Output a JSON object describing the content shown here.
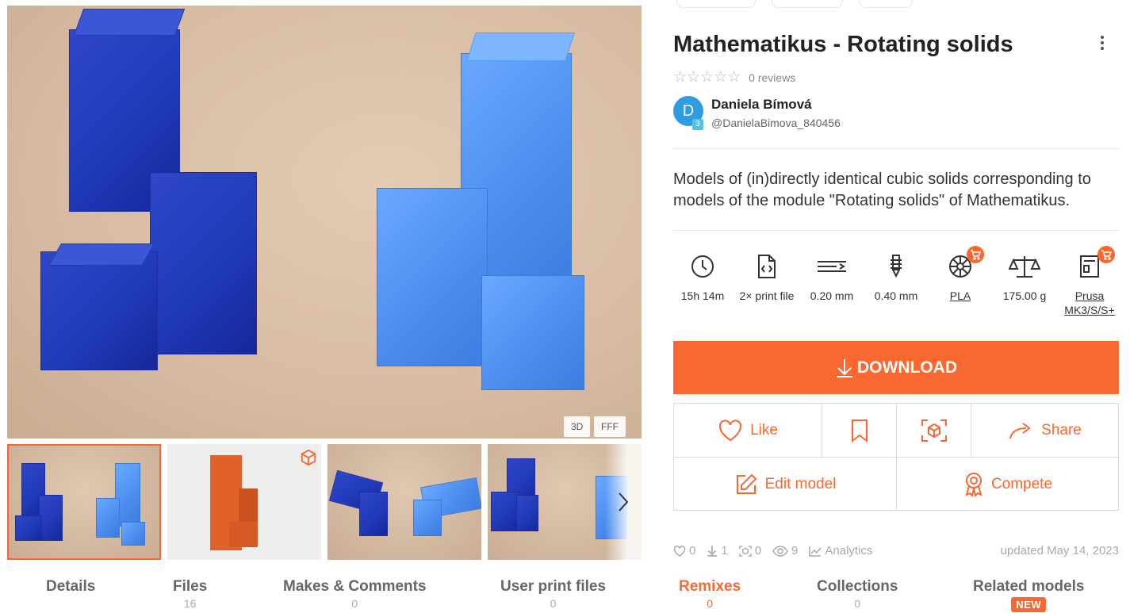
{
  "gallery": {
    "badges": [
      "3D",
      "FFF"
    ]
  },
  "model": {
    "title": "Mathematikus - Rotating solids",
    "rating": {
      "stars": 0,
      "reviews_label": "0 reviews"
    },
    "author": {
      "name": "Daniela Bímová",
      "handle": "@DanielaBimova_840456",
      "avatar_letter": "D",
      "level": "3"
    },
    "description": "Models of (in)directly identical cubic solids corresponding to models of the module \"Rotating solids\" of Mathematikus."
  },
  "specs": [
    {
      "icon": "clock-icon",
      "label": "15h 14m"
    },
    {
      "icon": "file-code-icon",
      "label": "2× print file"
    },
    {
      "icon": "layer-height-icon",
      "label": "0.20 mm"
    },
    {
      "icon": "nozzle-icon",
      "label": "0.40 mm"
    },
    {
      "icon": "filament-spool-icon",
      "label": "PLA"
    },
    {
      "icon": "scale-icon",
      "label": "175.00 g"
    },
    {
      "icon": "printer-icon",
      "label": "Prusa MK3/S/S+"
    }
  ],
  "download_label": "DOWNLOAD",
  "actions": {
    "like": "Like",
    "share": "Share",
    "edit": "Edit model",
    "compete": "Compete"
  },
  "stats": {
    "likes": "0",
    "downloads": "1",
    "makes": "0",
    "views": "9",
    "analytics": "Analytics",
    "updated": "updated May 14, 2023"
  },
  "tabs": [
    {
      "label": "Details",
      "count": ""
    },
    {
      "label": "Files",
      "count": "16"
    },
    {
      "label": "Makes & Comments",
      "count": "0"
    },
    {
      "label": "User print files",
      "count": "0"
    },
    {
      "label": "Remixes",
      "count": "0"
    },
    {
      "label": "Collections",
      "count": "0"
    },
    {
      "label": "Related models",
      "count": "",
      "badge": "NEW"
    }
  ],
  "colors": {
    "accent": "#fa6831",
    "dark_blue": "#2039b8",
    "light_blue": "#4d8ff0"
  }
}
